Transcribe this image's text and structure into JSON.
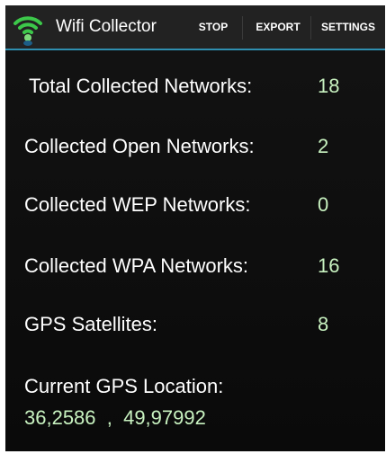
{
  "app": {
    "title": "Wifi Collector",
    "icon": "wifi-icon"
  },
  "actions": {
    "stop": "STOP",
    "export": "EXPORT",
    "settings": "SETTINGS"
  },
  "stats": [
    {
      "label": "Total Collected Networks:",
      "value": "18"
    },
    {
      "label": "Collected Open Networks:",
      "value": "2"
    },
    {
      "label": "Collected WEP Networks:",
      "value": "0"
    },
    {
      "label": "Collected WPA Networks:",
      "value": "16"
    },
    {
      "label": "GPS Satellites:",
      "value": "8"
    }
  ],
  "gps": {
    "label": "Current GPS Location:",
    "coordinates": "36,2586  ,  49,97992"
  },
  "colors": {
    "accent_line": "#2f8fb0",
    "value_text": "#c8f2c0",
    "icon_green": "#34c759"
  }
}
